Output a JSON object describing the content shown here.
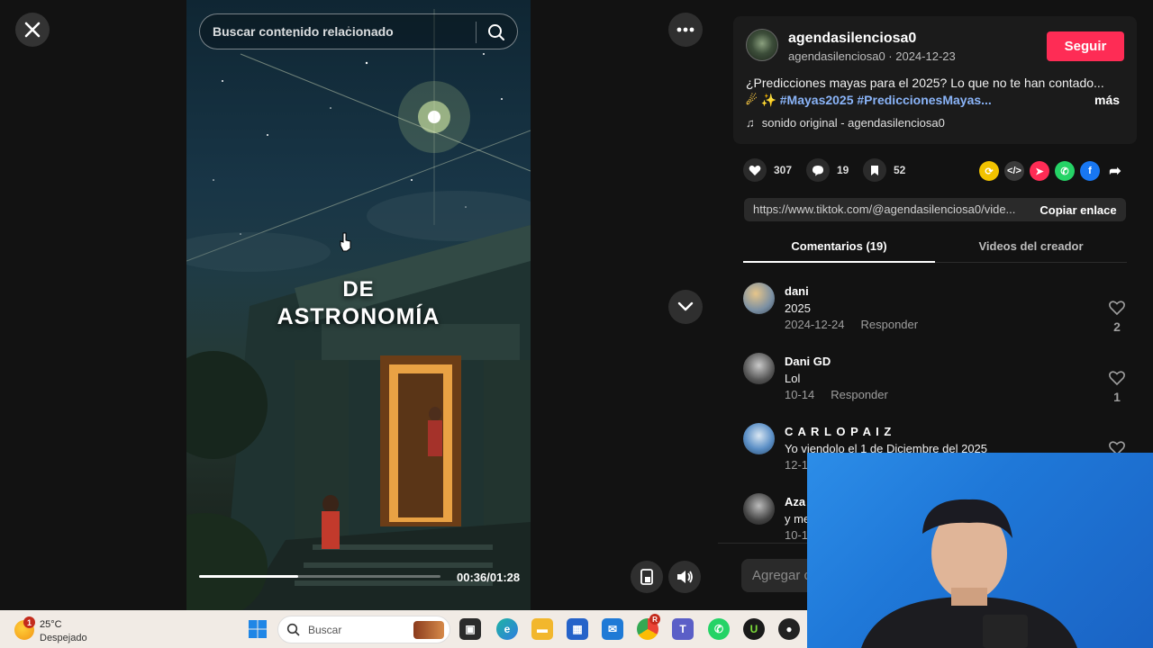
{
  "video": {
    "search_placeholder": "Buscar contenido relacionado",
    "title_line1": "DE",
    "title_line2": "ASTRONOMÍA",
    "time": "00:36/01:28",
    "progress_fraction": 0.41
  },
  "post": {
    "author": "agendasilenciosa0",
    "author_sub": "agendasilenciosa0 · 2024-12-23",
    "follow_label": "Seguir",
    "description": "¿Predicciones mayas para el 2025? Lo que no te han contado...",
    "tags": "#Mayas2025 #PrediccionesMayas...",
    "more_label": "más",
    "sound": "sonido original - agendasilenciosa0"
  },
  "stats": {
    "likes": "307",
    "comments": "19",
    "saves": "52"
  },
  "share": {
    "url": "https://www.tiktok.com/@agendasilenciosa0/vide...",
    "copy_label": "Copiar enlace"
  },
  "tabs": [
    {
      "label": "Comentarios (19)"
    },
    {
      "label": "Videos del creador"
    }
  ],
  "comments": [
    {
      "user": "dani",
      "text": "2025",
      "date": "2024-12-24",
      "reply": "Responder",
      "likes": "2"
    },
    {
      "user": "Dani GD",
      "text": "Lol",
      "date": "10-14",
      "reply": "Responder",
      "likes": "1"
    },
    {
      "user": "C A R L O  P A I Z",
      "text": "Yo viendolo el 1 de Diciembre del 2025",
      "date": "12-1",
      "reply": "",
      "likes": ""
    },
    {
      "user": "Aza",
      "text": "y me",
      "date": "10-1",
      "reply": "",
      "likes": ""
    }
  ],
  "add_comment_placeholder": "Agregar c",
  "taskbar": {
    "weather_temp": "25°C",
    "weather_cond": "Despejado",
    "weather_badge": "1",
    "search_label": "Buscar",
    "chrome_badge": "R"
  },
  "colors": {
    "accent": "#fe2c55",
    "link": "#8ab4f8"
  }
}
